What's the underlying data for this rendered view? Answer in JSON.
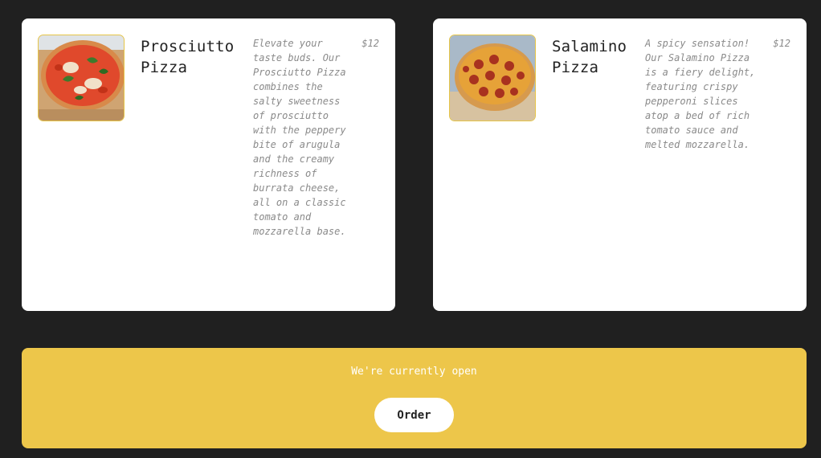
{
  "menu": {
    "items": [
      {
        "name": "Prosciutto Pizza",
        "description": "Elevate your taste buds. Our Prosciutto Pizza combines the salty sweetness of prosciutto with the peppery bite of arugula and the creamy richness of burrata cheese, all on a classic tomato and mozzarella base.",
        "price": "$12",
        "image_icon": "pizza-photo-prosciutto"
      },
      {
        "name": "Salamino Pizza",
        "description": "A spicy sensation! Our Salamino Pizza is a fiery delight, featuring crispy pepperoni slices atop a bed of rich tomato sauce and melted mozzarella.",
        "price": "$12",
        "image_icon": "pizza-photo-salamino"
      }
    ]
  },
  "status": {
    "text": "We're currently open",
    "order_label": "Order"
  },
  "colors": {
    "page_background": "#202020",
    "card_background": "#ffffff",
    "accent": "#edc64a",
    "title_text": "#222222",
    "muted_text": "#8a8a8a"
  }
}
